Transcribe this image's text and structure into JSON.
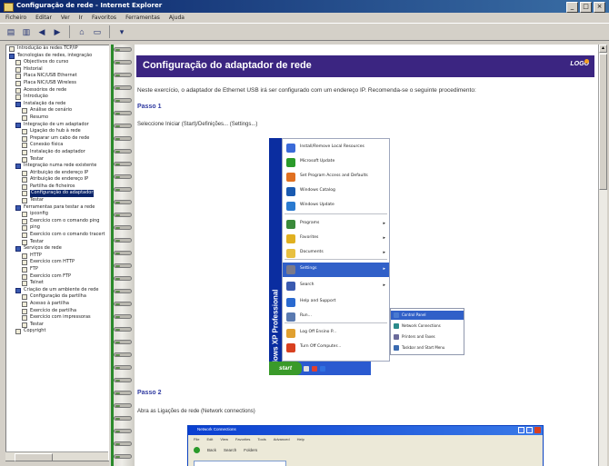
{
  "window": {
    "title": "Configuração de rede - Internet Explorer"
  },
  "menu": [
    "Ficheiro",
    "Editar",
    "Ver",
    "Ir",
    "Favoritos",
    "Ferramentas",
    "Ajuda"
  ],
  "tree": [
    "Introdução às redes TCP/IP",
    "Tecnologias de redes, integração",
    "Objectivos do curso",
    "Historial",
    "Placa NIC/USB Ethernet",
    "Placa NIC/USB Wireless",
    "Acessórios de rede",
    "Introdução",
    "Instalação da rede",
    "Análise de cenário",
    "Resumo",
    "Integração de um adaptador",
    "Ligação do hub à rede",
    "Preparar um cabo de rede",
    "Conexão física",
    "Instalação do adaptador",
    "Testar",
    "Integração numa rede existente",
    "Atribuição de endereço IP",
    "Atribuição de endereço IP",
    "Partilha de ficheiros",
    "Configuração do adaptador",
    "Testar",
    "Ferramentas para testar a rede",
    "ipconfig",
    "Exercício com o comando ping",
    "ping",
    "Exercício com o comando tracert",
    "Testar",
    "Serviços de rede",
    "HTTP",
    "Exercício com HTTP",
    "FTP",
    "Exercício com FTP",
    "Telnet",
    "Criação de um ambiente de rede",
    "Configuração da partilha",
    "Acesso à partilha",
    "Exercício de partilha",
    "Exercício com impressoras",
    "Testar",
    "Copyright"
  ],
  "page": {
    "title": "Configuração do adaptador de rede",
    "logo": "LOGO",
    "intro": "Neste exercício, o adaptador de Ethernet USB irá ser configurado com um endereço IP. Recomenda-se o seguinte procedimento:",
    "step1_title": "Passo 1",
    "step1_text": "Seleccione Iniciar (Start)/Definições... (Settings...)",
    "step2_title": "Passo 2",
    "step2_text": "Abra as Ligações de rede (Network connections)"
  },
  "startmenu": {
    "brand": "Windows XP Professional",
    "items": [
      {
        "label": "Install/Remove Local Resources",
        "color": "#3a6ad8",
        "arrow": ""
      },
      {
        "label": "Microsoft Update",
        "color": "#2a9a2a",
        "arrow": ""
      },
      {
        "label": "Set Program Access and Defaults",
        "color": "#e07020",
        "arrow": ""
      },
      {
        "label": "Windows Catalog",
        "color": "#1a5ab0",
        "arrow": ""
      },
      {
        "label": "Windows Update",
        "color": "#2a7ad0",
        "arrow": ""
      },
      {
        "label": "Programs",
        "color": "#3a8a3a",
        "arrow": "▸"
      },
      {
        "label": "Favorites",
        "color": "#e0b020",
        "arrow": "▸"
      },
      {
        "label": "Documents",
        "color": "#e8c040",
        "arrow": "▸"
      },
      {
        "label": "Settings",
        "color": "#7a7a8a",
        "arrow": "▸"
      },
      {
        "label": "Search",
        "color": "#3a5ab0",
        "arrow": "▸"
      },
      {
        "label": "Help and Support",
        "color": "#2a6ad0",
        "arrow": ""
      },
      {
        "label": "Run...",
        "color": "#5a7ab0",
        "arrow": ""
      },
      {
        "label": "Log Off Ensino P...",
        "color": "#e0a030",
        "arrow": ""
      },
      {
        "label": "Turn Off Computer...",
        "color": "#d84020",
        "arrow": ""
      }
    ],
    "submenu": [
      {
        "label": "Control Panel",
        "color": "#4a7ad0"
      },
      {
        "label": "Network Connections",
        "color": "#2a8a8a"
      },
      {
        "label": "Printers and Faxes",
        "color": "#6a6a9a"
      },
      {
        "label": "Taskbar and Start Menu",
        "color": "#3a6ab0"
      }
    ],
    "start_label": "start"
  },
  "netwin": {
    "title": "Network Connections",
    "menu": [
      "File",
      "Edit",
      "View",
      "Favorites",
      "Tools",
      "Advanced",
      "Help"
    ],
    "toolbar": [
      "Back",
      "Search",
      "Folders"
    ]
  }
}
